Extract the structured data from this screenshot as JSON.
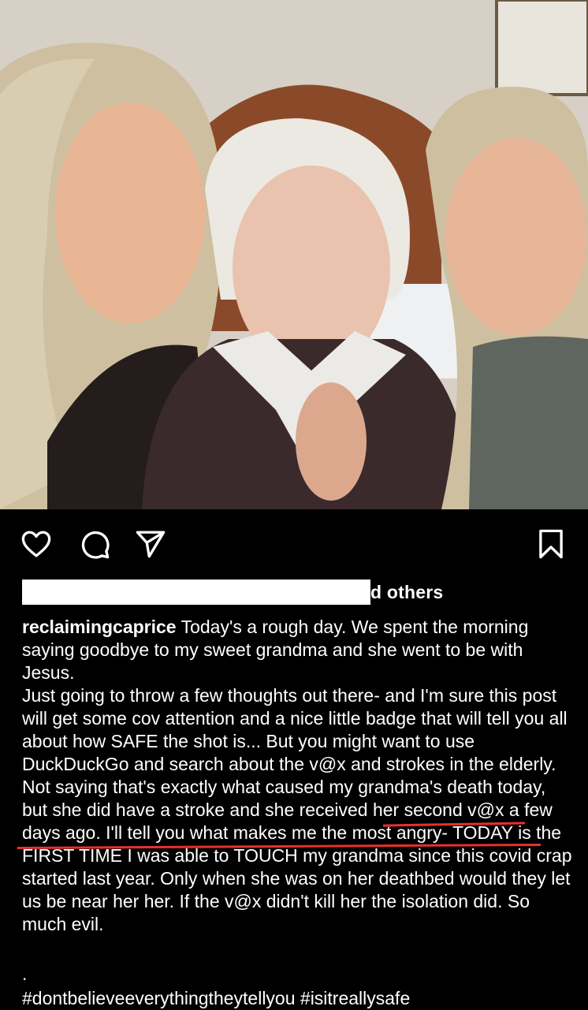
{
  "post": {
    "actions": {
      "like_icon": "heart-icon",
      "comment_icon": "comment-icon",
      "share_icon": "send-icon",
      "save_icon": "bookmark-icon"
    },
    "likes_suffix": "d others",
    "caption": {
      "username": "reclaimingcaprice",
      "line1": " Today's a rough day. We spent the morning saying goodbye to my sweet grandma and she went to be with Jesus.",
      "para2_start": "Just going to throw a few thoughts out there- and I'm sure this post will get some cov attention and a nice little badge that will tell you all about how SAFE the shot is... But you might want to use DuckDuckGo and search about the v@x and strokes in the elderly. Not saying that's exactly what caused my grandma's death today, but ",
      "para2_highlight": "she did have a stroke and she received her second v@x a few days ago.",
      "para2_end": " I'll tell you what makes me the most angry- TODAY is the FIRST TIME I was able to TOUCH my grandma since this covid crap started last year. Only when she was on her deathbed would they let us be near her her. If the v@x didn't kill her the isolation did. So much evil.",
      "dot": ".",
      "hashtags": "#dontbelieveeverythingtheytellyou #isitreallysafe"
    },
    "colors": {
      "background": "#000000",
      "text": "#ffffff",
      "underline": "#e8302b"
    }
  }
}
